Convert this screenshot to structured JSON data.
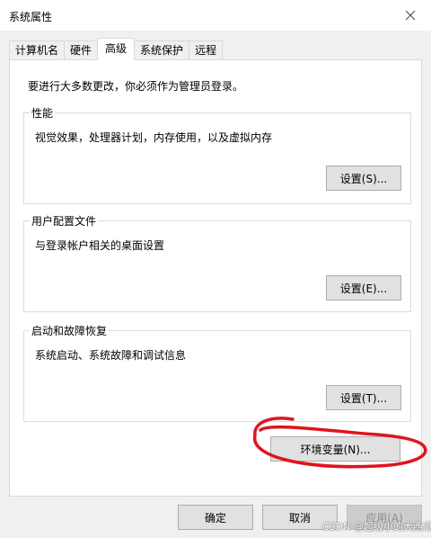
{
  "window": {
    "title": "系统属性"
  },
  "tabs": [
    {
      "label": "计算机名"
    },
    {
      "label": "硬件"
    },
    {
      "label": "高级"
    },
    {
      "label": "系统保护"
    },
    {
      "label": "远程"
    }
  ],
  "active_tab": "高级",
  "admin_note": "要进行大多数更改，你必须作为管理员登录。",
  "groups": {
    "performance": {
      "legend": "性能",
      "description": "视觉效果，处理器计划，内存使用，以及虚拟内存",
      "button": "设置(S)..."
    },
    "user_profiles": {
      "legend": "用户配置文件",
      "description": "与登录帐户相关的桌面设置",
      "button": "设置(E)..."
    },
    "startup_recovery": {
      "legend": "启动和故障恢复",
      "description": "系统启动、系统故障和调试信息",
      "button": "设置(T)..."
    }
  },
  "env_button": "环境变量(N)...",
  "footer": {
    "ok": "确定",
    "cancel": "取消",
    "apply": "应用(A)"
  },
  "watermark": "CSDN @超级小的大西瓜",
  "colors": {
    "annotation": "#e0141e",
    "panel_background": "#ffffff",
    "dialog_background": "#f0f0f0"
  },
  "icons": {
    "close": "close-icon"
  }
}
